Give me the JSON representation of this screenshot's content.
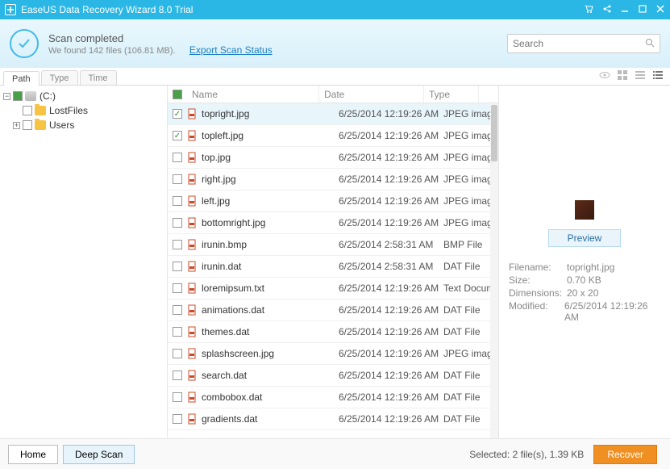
{
  "titlebar": {
    "title": "EaseUS Data Recovery Wizard 8.0 Trial"
  },
  "header": {
    "line1": "Scan completed",
    "line2": "We found 142 files (106.81 MB).",
    "export_link": "Export Scan Status",
    "search_placeholder": "Search"
  },
  "tabs": {
    "path": "Path",
    "type": "Type",
    "time": "Time"
  },
  "tree": {
    "root": "(C:)",
    "lostfiles": "LostFiles",
    "users": "Users"
  },
  "columns": {
    "name": "Name",
    "date": "Date",
    "type": "Type"
  },
  "files": [
    {
      "name": "topright.jpg",
      "date": "6/25/2014 12:19:26 AM",
      "type": "JPEG imag",
      "checked": true,
      "selected": true
    },
    {
      "name": "topleft.jpg",
      "date": "6/25/2014 12:19:26 AM",
      "type": "JPEG imag",
      "checked": true
    },
    {
      "name": "top.jpg",
      "date": "6/25/2014 12:19:26 AM",
      "type": "JPEG imag"
    },
    {
      "name": "right.jpg",
      "date": "6/25/2014 12:19:26 AM",
      "type": "JPEG imag"
    },
    {
      "name": "left.jpg",
      "date": "6/25/2014 12:19:26 AM",
      "type": "JPEG imag"
    },
    {
      "name": "bottomright.jpg",
      "date": "6/25/2014 12:19:26 AM",
      "type": "JPEG imag"
    },
    {
      "name": "irunin.bmp",
      "date": "6/25/2014 2:58:31 AM",
      "type": "BMP File"
    },
    {
      "name": "irunin.dat",
      "date": "6/25/2014 2:58:31 AM",
      "type": "DAT File"
    },
    {
      "name": "loremipsum.txt",
      "date": "6/25/2014 12:19:26 AM",
      "type": "Text Docum"
    },
    {
      "name": "animations.dat",
      "date": "6/25/2014 12:19:26 AM",
      "type": "DAT File"
    },
    {
      "name": "themes.dat",
      "date": "6/25/2014 12:19:26 AM",
      "type": "DAT File"
    },
    {
      "name": "splashscreen.jpg",
      "date": "6/25/2014 12:19:26 AM",
      "type": "JPEG imag"
    },
    {
      "name": "search.dat",
      "date": "6/25/2014 12:19:26 AM",
      "type": "DAT File"
    },
    {
      "name": "combobox.dat",
      "date": "6/25/2014 12:19:26 AM",
      "type": "DAT File"
    },
    {
      "name": "gradients.dat",
      "date": "6/25/2014 12:19:26 AM",
      "type": "DAT File"
    }
  ],
  "preview": {
    "button": "Preview",
    "labels": {
      "filename": "Filename:",
      "size": "Size:",
      "dimensions": "Dimensions:",
      "modified": "Modified:"
    },
    "values": {
      "filename": "topright.jpg",
      "size": "0.70 KB",
      "dimensions": "20 x 20",
      "modified": "6/25/2014 12:19:26 AM"
    }
  },
  "footer": {
    "home": "Home",
    "deep_scan": "Deep Scan",
    "selected": "Selected: 2 file(s), 1.39 KB",
    "recover": "Recover"
  }
}
